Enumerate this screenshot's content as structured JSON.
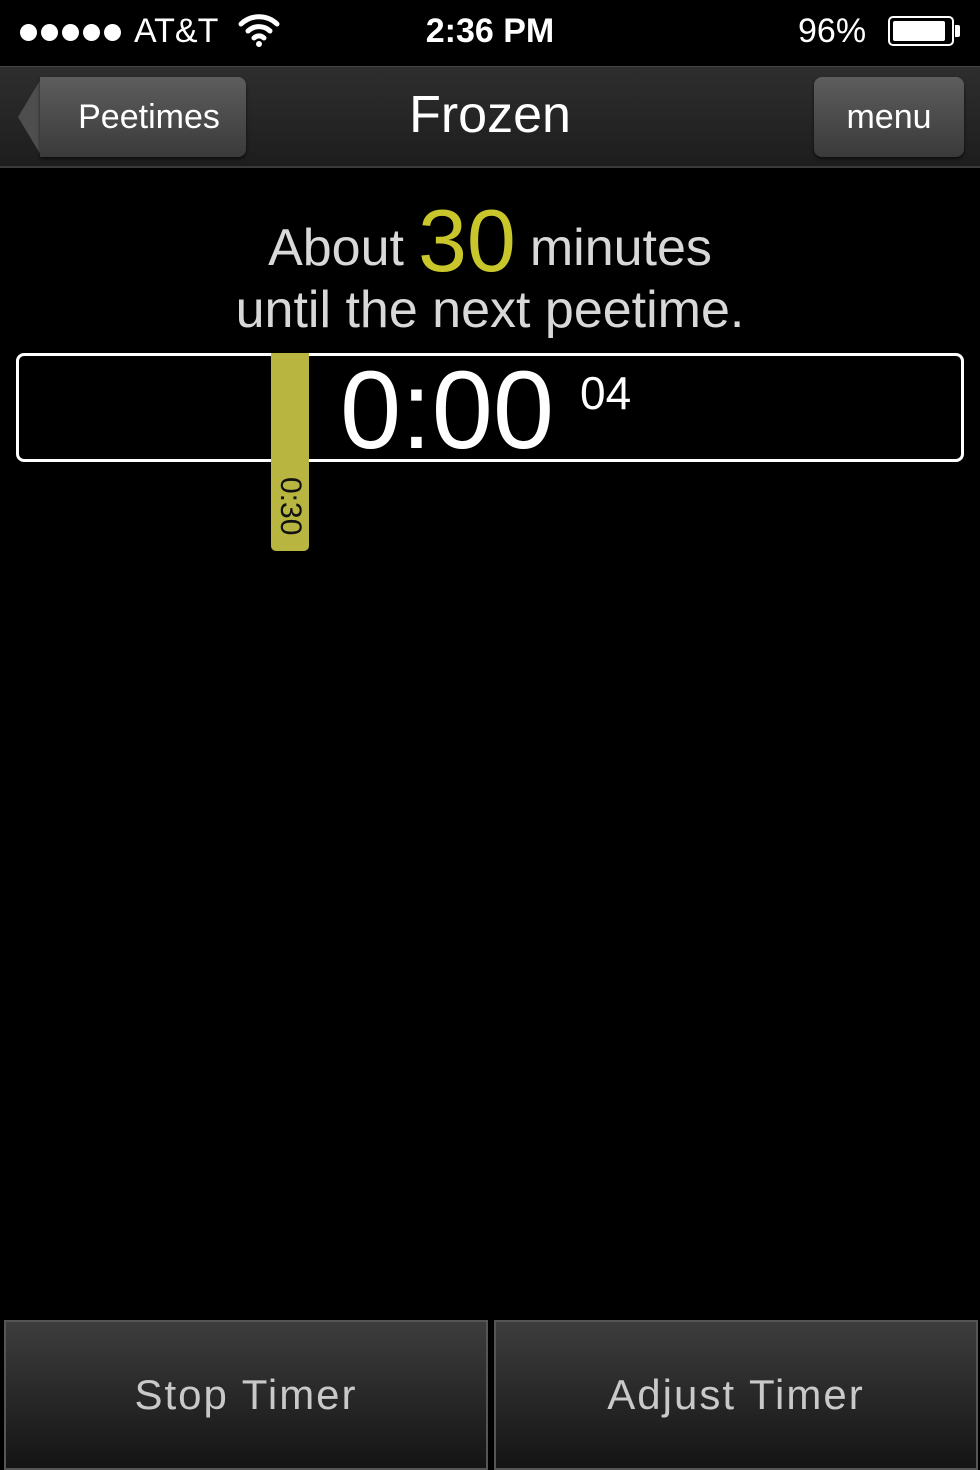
{
  "status_bar": {
    "carrier": "AT&T",
    "time": "2:36 PM",
    "battery_percent": "96%",
    "signal_bars": 5,
    "battery_level": 0.96
  },
  "nav": {
    "back_label": "Peetimes",
    "title": "Frozen",
    "menu_label": "menu"
  },
  "message": {
    "prefix": "About",
    "minutes": "30",
    "suffix": "minutes",
    "line2": "until the next peetime."
  },
  "timer": {
    "main": "0:00",
    "seconds": "04",
    "marker_label": "0:30"
  },
  "actions": {
    "stop_label": "Stop Timer",
    "adjust_label": "Adjust Timer"
  },
  "colors": {
    "accent": "#c8c62a",
    "marker": "#b8b640"
  }
}
